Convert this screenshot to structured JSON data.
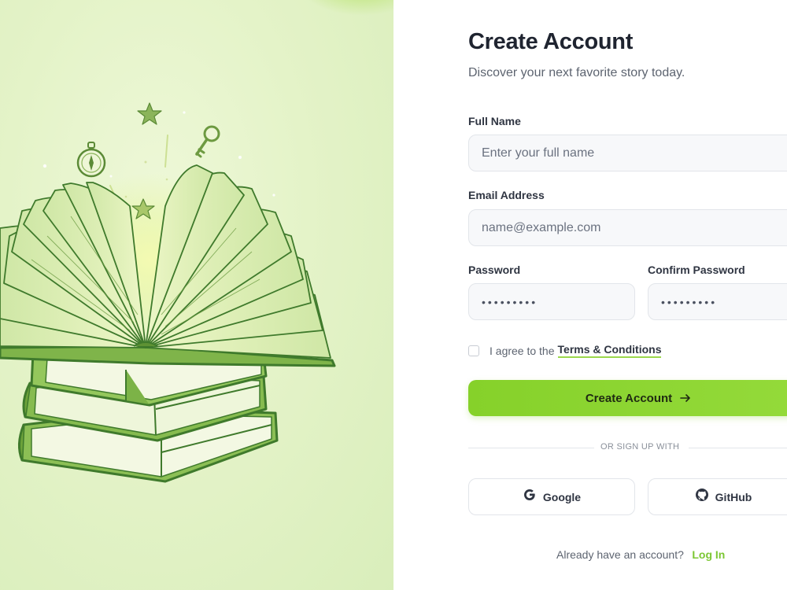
{
  "form": {
    "title": "Create Account",
    "subtitle": "Discover your next favorite story today.",
    "full_name": {
      "label": "Full Name",
      "placeholder": "Enter your full name",
      "value": ""
    },
    "email": {
      "label": "Email Address",
      "placeholder": "name@example.com",
      "value": ""
    },
    "password": {
      "label": "Password",
      "placeholder": "•••••••••",
      "value": ""
    },
    "confirm_password": {
      "label": "Confirm Password",
      "placeholder": "•••••••••",
      "value": ""
    },
    "terms": {
      "checked": false,
      "prefix": "I agree to the",
      "link_label": "Terms & Conditions"
    },
    "submit_label": "Create Account",
    "divider_label": "OR SIGN UP WITH",
    "social": [
      {
        "label": "Google",
        "icon": "google-icon"
      },
      {
        "label": "GitHub",
        "icon": "github-icon"
      }
    ],
    "login_prompt": "Already have an account?",
    "login_link": "Log In"
  },
  "illustration": {
    "icons": [
      "star-icon",
      "compass-icon",
      "key-icon",
      "star-icon"
    ],
    "subject": "open-book-on-stack-icon"
  },
  "colors": {
    "accent": "#8ad330",
    "link_green": "#7cc733",
    "panel_bg": "#e4f3c8",
    "text_dark": "#1f2430"
  }
}
